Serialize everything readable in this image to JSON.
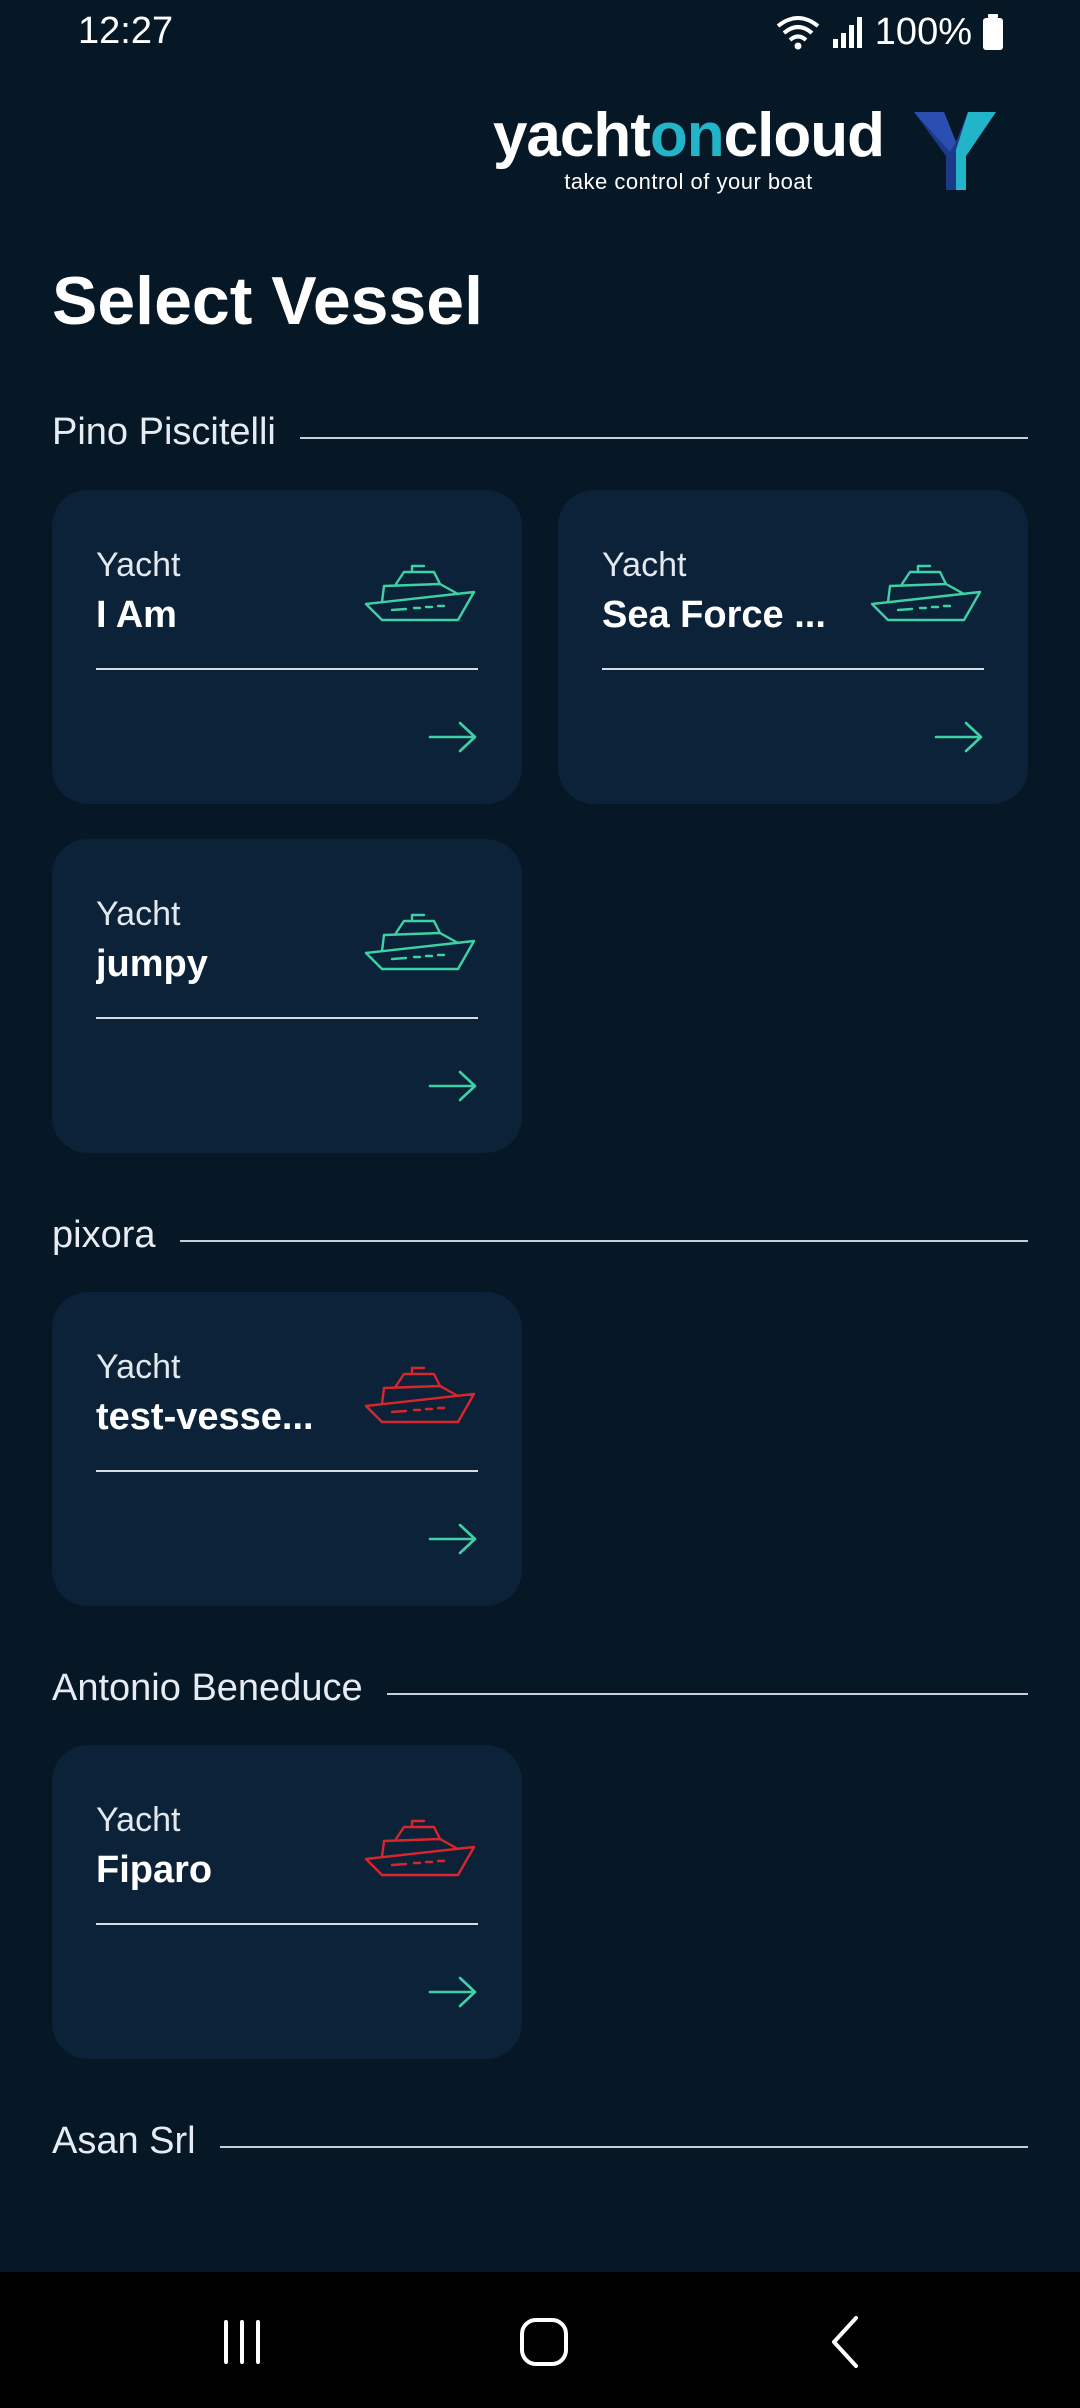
{
  "status_bar": {
    "time": "12:27",
    "battery": "100%"
  },
  "logo": {
    "brand_part1": "yacht",
    "brand_part2": "on",
    "brand_part3": "cloud",
    "tagline": "take control of your boat"
  },
  "page": {
    "title": "Select Vessel"
  },
  "sections": [
    {
      "owner": "Pino Piscitelli",
      "vessels": [
        {
          "type": "Yacht",
          "name": "I Am",
          "status_color": "#3ed1a6"
        },
        {
          "type": "Yacht",
          "name": "Sea Force ...",
          "status_color": "#3ed1a6"
        },
        {
          "type": "Yacht",
          "name": "jumpy",
          "status_color": "#3ed1a6"
        }
      ]
    },
    {
      "owner": "pixora",
      "vessels": [
        {
          "type": "Yacht",
          "name": "test-vesse...",
          "status_color": "#d8262c"
        }
      ]
    },
    {
      "owner": "Antonio Beneduce",
      "vessels": [
        {
          "type": "Yacht",
          "name": "Fiparo",
          "status_color": "#d8262c"
        }
      ]
    },
    {
      "owner": "Asan Srl",
      "vessels": []
    }
  ],
  "colors": {
    "accent": "#22b5c9",
    "arrow": "#3ed1a6",
    "background": "#061726",
    "card": "#0c2238"
  }
}
